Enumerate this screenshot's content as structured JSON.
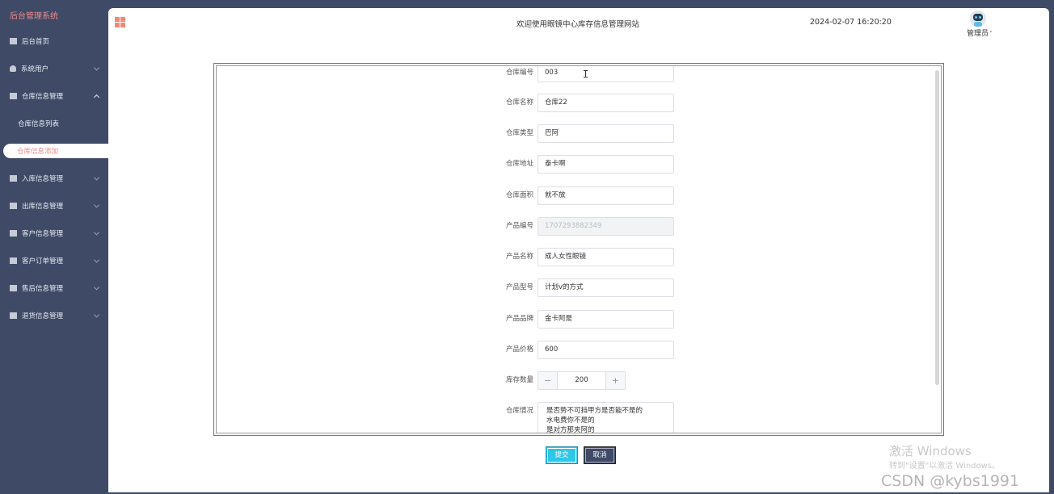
{
  "sidebar": {
    "brand": "后台管理系统",
    "items": [
      {
        "label": "后台首页",
        "icon": "monitor-icon"
      },
      {
        "label": "系统用户",
        "icon": "user-icon"
      },
      {
        "label": "仓库信息管理",
        "icon": "checkbox-icon"
      },
      {
        "label": "入库信息管理",
        "icon": "checkbox-icon"
      },
      {
        "label": "出库信息管理",
        "icon": "checkbox-icon"
      },
      {
        "label": "客户信息管理",
        "icon": "checkbox-icon"
      },
      {
        "label": "客户订单管理",
        "icon": "checkbox-icon"
      },
      {
        "label": "售后信息管理",
        "icon": "checkbox-icon"
      },
      {
        "label": "退货信息管理",
        "icon": "checkbox-icon"
      }
    ],
    "submenu": [
      {
        "label": "仓库信息列表"
      },
      {
        "label": "仓库信息添加"
      }
    ]
  },
  "header": {
    "welcome": "欢迎使用眼镜中心库存信息管理网站",
    "datetime": "2024-02-07 16:20:20",
    "user": "管理员",
    "caret": "˅"
  },
  "form": {
    "fields": [
      {
        "label": "仓库编号",
        "value": "003"
      },
      {
        "label": "仓库名称",
        "value": "仓库22"
      },
      {
        "label": "仓库类型",
        "value": "巴阿"
      },
      {
        "label": "仓库地址",
        "value": "泰卡啊"
      },
      {
        "label": "仓库面积",
        "value": "就不放"
      },
      {
        "label": "产品编号",
        "value": "1707293882349"
      },
      {
        "label": "产品名称",
        "value": "成人女性眼镜"
      },
      {
        "label": "产品型号",
        "value": "计划v的方式"
      },
      {
        "label": "产品品牌",
        "value": "金卡阿是"
      },
      {
        "label": "产品价格",
        "value": "600"
      }
    ],
    "stock": {
      "label": "库存数量",
      "value": "200",
      "minus": "−",
      "plus": "+"
    },
    "notes": {
      "label": "仓库情况",
      "value": "是否势不可挡甲方是否能不是的\n水电费你不是的\n是对方那夹阿的"
    },
    "submit": "提交",
    "cancel": "取消"
  },
  "watermark": {
    "line1": "激活 Windows",
    "line2": "转到\"设置\"以激活 Windows。",
    "line3": "CSDN @kybs1991"
  },
  "colors": {
    "sidebar_bg": "#3e4a66",
    "accent": "#f08a8a",
    "submit": "#2ec7ea"
  }
}
